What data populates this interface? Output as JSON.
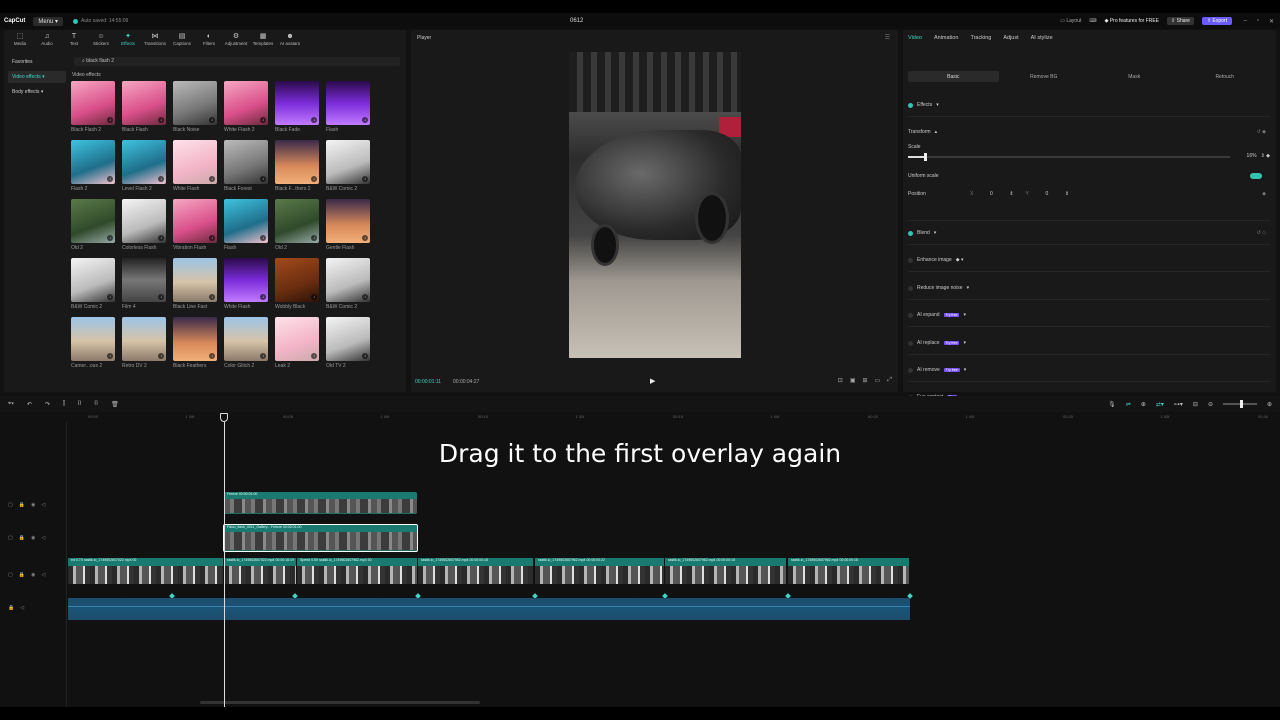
{
  "titlebar": {
    "app_name": "CapCut",
    "menu_label": "Menu",
    "autosave": "Auto saved: 14:55:09",
    "project_name": "0612",
    "layout_label": "Layout",
    "pro_label": "Pro features for FREE",
    "share_label": "Share",
    "export_label": "Export"
  },
  "media_tabs": [
    {
      "label": "Media",
      "icon": "media-icon"
    },
    {
      "label": "Audio",
      "icon": "audio-icon"
    },
    {
      "label": "Text",
      "icon": "text-icon"
    },
    {
      "label": "Stickers",
      "icon": "stickers-icon"
    },
    {
      "label": "Effects",
      "icon": "effects-icon",
      "active": true
    },
    {
      "label": "Transitions",
      "icon": "transitions-icon"
    },
    {
      "label": "Captions",
      "icon": "captions-icon"
    },
    {
      "label": "Filters",
      "icon": "filters-icon"
    },
    {
      "label": "Adjustment",
      "icon": "adjustment-icon"
    },
    {
      "label": "Templates",
      "icon": "templates-icon"
    },
    {
      "label": "AI avatars",
      "icon": "ai-avatars-icon"
    }
  ],
  "sidebar": {
    "favorites": "Favorites",
    "video_effects": "Video effects",
    "body_effects": "Body effects"
  },
  "search": {
    "value": "black flash 2"
  },
  "section_title": "Video effects",
  "effects": [
    {
      "name": "Black Flash 2",
      "style": "pink"
    },
    {
      "name": "Black Flash",
      "style": "pink"
    },
    {
      "name": "Black Noise",
      "style": "gray"
    },
    {
      "name": "White Flash 2",
      "style": "pink"
    },
    {
      "name": "Black Fade",
      "style": "purple"
    },
    {
      "name": "Flash",
      "style": "purple"
    },
    {
      "name": "Flash 2",
      "style": "teal"
    },
    {
      "name": "Level Flash 2",
      "style": "teal"
    },
    {
      "name": "White Flash",
      "style": "pinklight"
    },
    {
      "name": "Black Forest",
      "style": "gray"
    },
    {
      "name": "Black F...thers 2",
      "style": "sunset"
    },
    {
      "name": "B&W Comic 2",
      "style": "bw"
    },
    {
      "name": "Old 2",
      "style": "green"
    },
    {
      "name": "Colorless Flash",
      "style": "bw"
    },
    {
      "name": "Vibration Flash",
      "style": "pink"
    },
    {
      "name": "Flash",
      "style": "teal"
    },
    {
      "name": "Old 2",
      "style": "green"
    },
    {
      "name": "Gentle Flash",
      "style": "sunset"
    },
    {
      "name": "B&W Comic 2",
      "style": "bw"
    },
    {
      "name": "Film 4",
      "style": "film"
    },
    {
      "name": "Black Line Fast",
      "style": "city"
    },
    {
      "name": "White Flash",
      "style": "purple"
    },
    {
      "name": "Wobbly Black",
      "style": "tv"
    },
    {
      "name": "B&W Comic 2",
      "style": "bw"
    },
    {
      "name": "Camer...ous 2",
      "style": "city"
    },
    {
      "name": "Retro DV 2",
      "style": "city"
    },
    {
      "name": "Black Feathers",
      "style": "sunset"
    },
    {
      "name": "Color Glitch 2",
      "style": "city"
    },
    {
      "name": "Leak 2",
      "style": "pinklight"
    },
    {
      "name": "Old TV 2",
      "style": "bw"
    }
  ],
  "player": {
    "title": "Player",
    "current_time": "00:00:01:11",
    "total_time": "00:00:04:27"
  },
  "right_panel": {
    "tabs": [
      "Video",
      "Animation",
      "Tracking",
      "Adjust",
      "AI stylize"
    ],
    "subtabs": [
      "Basic",
      "Remove BG",
      "Mask",
      "Retouch"
    ],
    "effects_label": "Effects",
    "transform_label": "Transform",
    "scale_label": "Scale",
    "scale_value": "16%",
    "scale_level": 0.05,
    "uniform_scale_label": "Uniform scale",
    "position_label": "Position",
    "pos_x_label": "X",
    "pos_x_value": "0",
    "pos_y_label": "Y",
    "pos_y_value": "0",
    "blend_label": "Blend",
    "enhance_label": "Enhance image",
    "reduce_noise_label": "Reduce image noise",
    "ai_expand_label": "AI expand",
    "ai_replace_label": "AI replace",
    "ai_remove_label": "AI remove",
    "eye_contact_label": "Eye contact",
    "try_free": "Try free",
    "pro_tag": "Pro"
  },
  "timeline": {
    "ruler_ticks": [
      "00:00",
      "1 00f",
      "00:05",
      "1 00f",
      "00:10",
      "1 00f",
      "00:15",
      "1 00f",
      "00:20",
      "1 00f",
      "00:25",
      "1 00f",
      "00:30",
      "1 00f",
      "00:35",
      "1 00f",
      "00:40",
      "1 00f",
      "00:45",
      "1 00f",
      "00:50",
      "1 00f",
      "00:55"
    ],
    "overlay_top_label": "Freeze  00:00:01:00",
    "overlay_sel_label": "Fikou_flash_0011_Gallery... Freeze  00:00:01:00",
    "main_clips": [
      {
        "label": "ed 0.7X  ssstik.io_1749502607022.mp4  00"
      },
      {
        "label": "ssstik.io_1749502607022.mp4  00:00:16:19"
      },
      {
        "label": "Speed 0.5X  ssstik.io_1749502607962.mp4  00"
      },
      {
        "label": "ssstik.io_1749502607962.mp4  00:00:00:18"
      },
      {
        "label": "ssstik.io_1749502607962.mp4  00:00:00:22"
      },
      {
        "label": "ssstik.io_1749502607962.mp4  00:00:00:18"
      },
      {
        "label": "ssstik.io_1749502607962.mp4  00:00:00:18"
      }
    ]
  },
  "caption": "Drag it to the first overlay again"
}
